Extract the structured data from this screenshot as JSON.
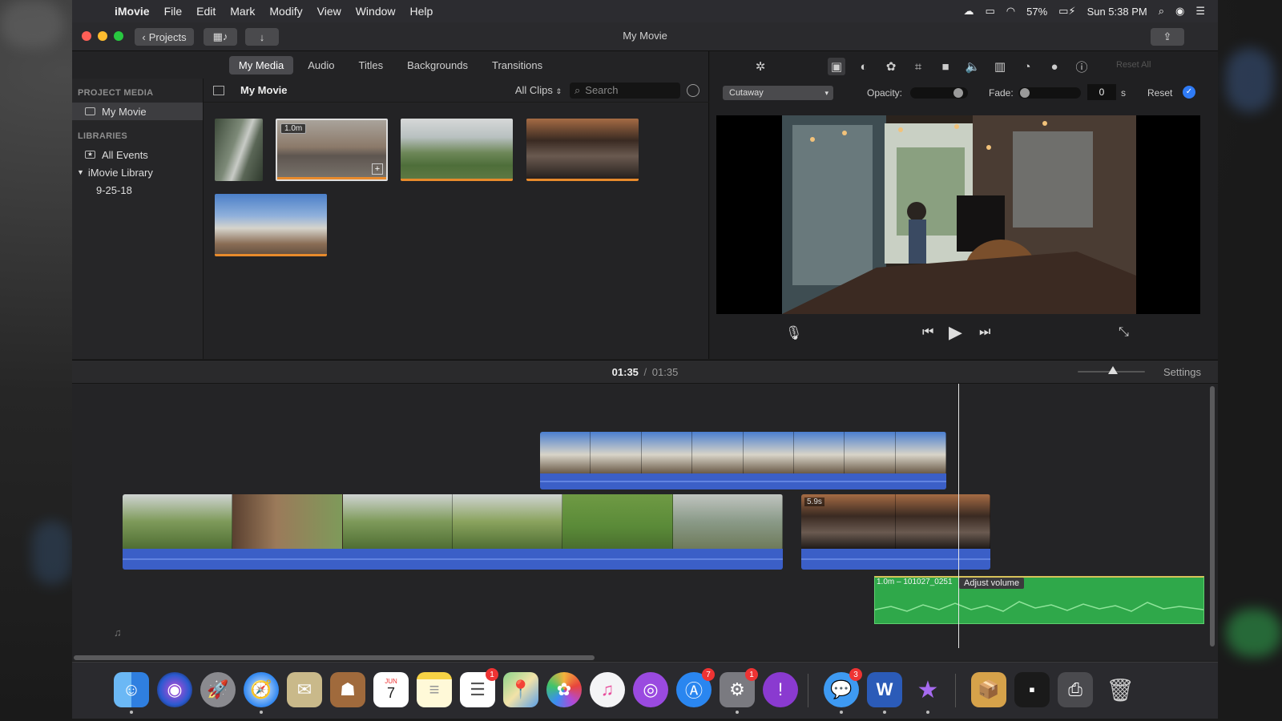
{
  "menubar": {
    "apple": "",
    "items": [
      "iMovie",
      "File",
      "Edit",
      "Mark",
      "Modify",
      "View",
      "Window",
      "Help"
    ],
    "battery": "57%",
    "clock": "Sun 5:38 PM"
  },
  "window": {
    "title": "My Movie",
    "projects_label": "Projects",
    "traffic_colors": [
      "#fe5f57",
      "#febc2e",
      "#28c840"
    ]
  },
  "browser": {
    "tabs": [
      "My Media",
      "Audio",
      "Titles",
      "Backgrounds",
      "Transitions"
    ],
    "active_tab": "My Media",
    "sidebar": {
      "project_media_heading": "PROJECT MEDIA",
      "project_item": "My Movie",
      "libraries_heading": "LIBRARIES",
      "all_events": "All Events",
      "library_name": "iMovie Library",
      "event_date": "9-25-18"
    },
    "media_title": "My Movie",
    "clips_filter": "All Clips",
    "search_placeholder": "Search",
    "thumb_badge": "1.0m"
  },
  "viewer": {
    "overlay_mode": "Cutaway",
    "opacity_label": "Opacity:",
    "opacity_level": 0.9,
    "fade_label": "Fade:",
    "fade_value": "0",
    "fade_unit": "s",
    "reset_label": "Reset",
    "reset_all_label": "Reset All"
  },
  "timeline": {
    "current_time": "01:35",
    "separator": "/",
    "total_time": "01:35",
    "settings_label": "Settings",
    "clip_badge": "5.9s",
    "audio_clip_label": "1.0m – 101027_0251",
    "tooltip": "Adjust volume"
  },
  "dock": {
    "badges": {
      "reminders": "1",
      "appstore": "7",
      "sysprefs": "1",
      "messages": "3"
    },
    "calendar_month": "JUN",
    "calendar_day": "7",
    "word_letter": "W"
  }
}
